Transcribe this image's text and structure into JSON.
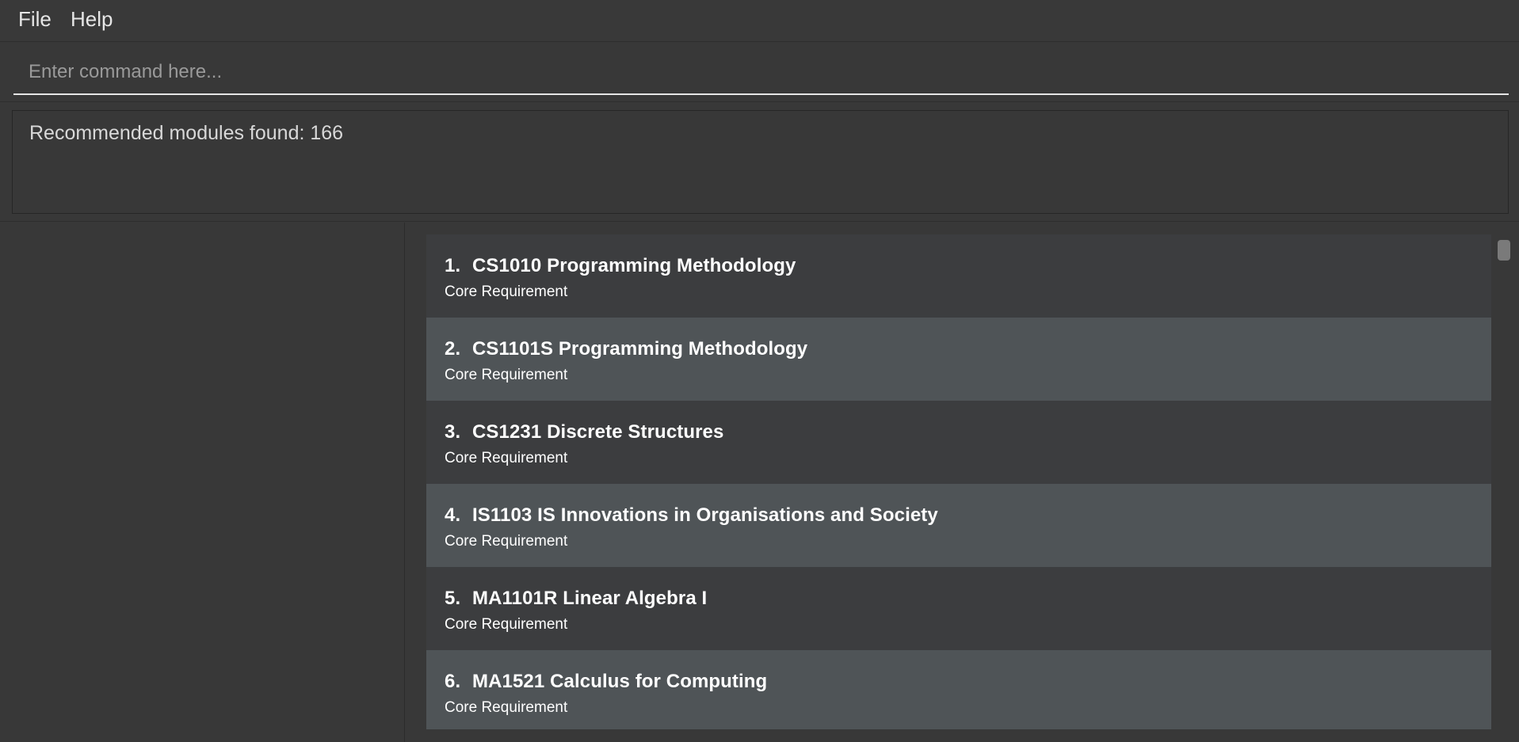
{
  "menu": {
    "file": "File",
    "help": "Help"
  },
  "command": {
    "placeholder": "Enter command here...",
    "value": ""
  },
  "result": {
    "message": "Recommended modules found: 166"
  },
  "modules": [
    {
      "index": "1.",
      "code": "CS1010",
      "name": "Programming Methodology",
      "type": "Core Requirement"
    },
    {
      "index": "2.",
      "code": "CS1101S",
      "name": "Programming Methodology",
      "type": "Core Requirement"
    },
    {
      "index": "3.",
      "code": "CS1231",
      "name": "Discrete Structures",
      "type": "Core Requirement"
    },
    {
      "index": "4.",
      "code": "IS1103",
      "name": "IS Innovations in Organisations and Society",
      "type": "Core Requirement"
    },
    {
      "index": "5.",
      "code": "MA1101R",
      "name": "Linear Algebra I",
      "type": "Core Requirement"
    },
    {
      "index": "6.",
      "code": "MA1521",
      "name": "Calculus for Computing",
      "type": "Core Requirement"
    }
  ],
  "colors": {
    "background": "#383838",
    "row_odd": "#3c3d3f",
    "row_even": "#4f5457",
    "text": "#ffffff"
  }
}
